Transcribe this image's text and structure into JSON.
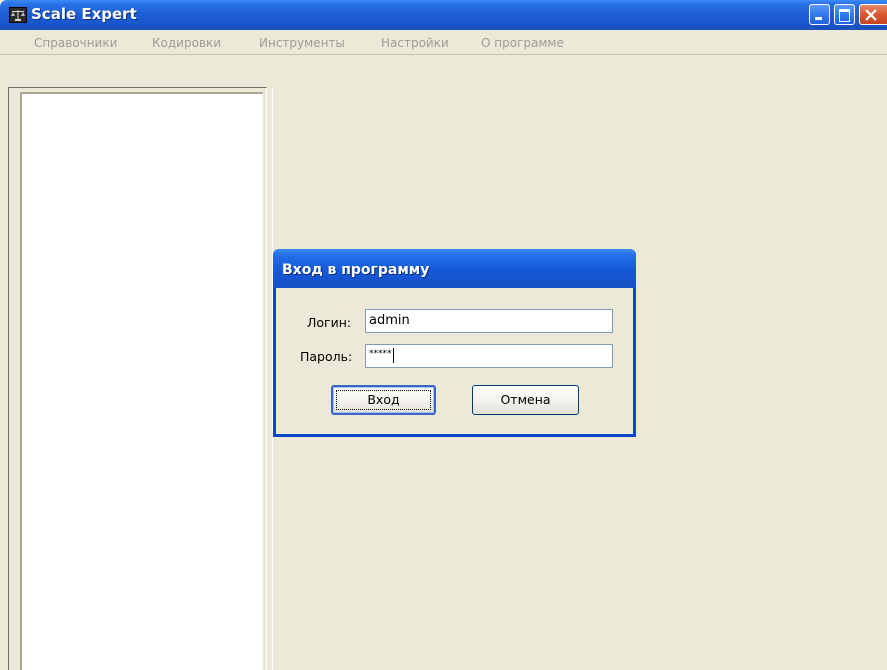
{
  "window": {
    "title": "Scale Expert",
    "icon": "scales-icon",
    "controls": [
      "minimize-icon",
      "maximize-icon",
      "close-icon"
    ]
  },
  "menu": {
    "items": [
      {
        "label": "Справочники",
        "enabled": false
      },
      {
        "label": "Кодировки",
        "enabled": false
      },
      {
        "label": "Инструменты",
        "enabled": false
      },
      {
        "label": "Настройки",
        "enabled": false
      },
      {
        "label": "О программе",
        "enabled": false
      }
    ]
  },
  "login_dialog": {
    "title": "Вход в программу",
    "login_label": "Логин:",
    "login_value": "admin",
    "password_label": "Пароль:",
    "password_value": "*****",
    "ok_label": "Вход",
    "cancel_label": "Отмена"
  },
  "colors": {
    "titlebar": "#1d5fd6",
    "window_bg": "#ece9d8",
    "menu_disabled_text": "#a09d90",
    "close_button": "#d9572f"
  }
}
